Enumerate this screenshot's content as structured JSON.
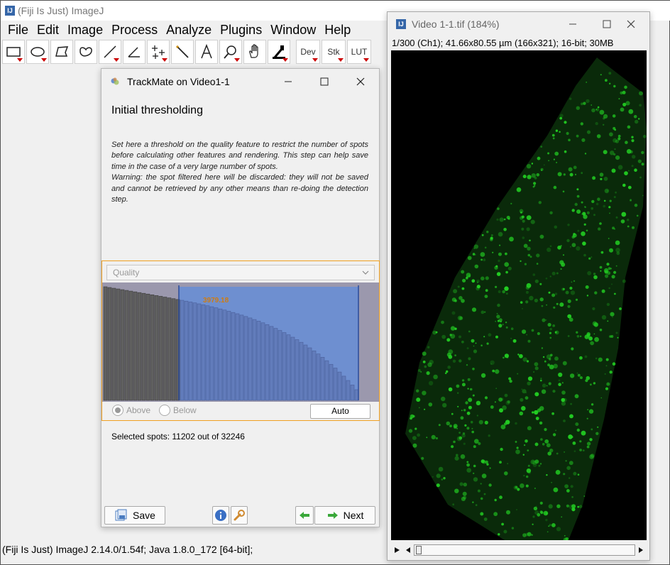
{
  "app": {
    "title": "(Fiji Is Just) ImageJ",
    "logo_text": "IJ",
    "menus": [
      "File",
      "Edit",
      "Image",
      "Process",
      "Analyze",
      "Plugins",
      "Window",
      "Help"
    ],
    "tools": [
      {
        "name": "rectangle-icon"
      },
      {
        "name": "oval-icon"
      },
      {
        "name": "polygon-icon"
      },
      {
        "name": "freehand-icon"
      },
      {
        "name": "line-icon"
      },
      {
        "name": "angle-icon"
      },
      {
        "name": "multipoint-icon"
      },
      {
        "name": "wand-icon"
      },
      {
        "name": "text-icon"
      },
      {
        "name": "magnifier-icon"
      },
      {
        "name": "hand-icon"
      },
      {
        "name": "dropper-icon"
      }
    ],
    "text_tools": [
      "Dev",
      "Stk",
      "LUT"
    ],
    "status": "(Fiji Is Just) ImageJ 2.14.0/1.54f; Java 1.8.0_172 [64-bit];"
  },
  "trackmate": {
    "title": "TrackMate on Video1-1",
    "heading": "Initial thresholding",
    "description": "Set here a threshold on the quality feature to restrict the number of spots before calculating other features and rendering. This step can help save time in the case of a very large number of spots.\nWarning: the spot filtered here will be discarded: they will not be saved and cannot be retrieved by any other means than re-doing the detection step.",
    "feature_select": "Quality",
    "threshold_value": "3979.18",
    "radio_above": "Above",
    "radio_below": "Below",
    "auto_label": "Auto",
    "selected_spots": "Selected spots: 11202 out of 32246",
    "save_label": "Save",
    "next_label": "Next",
    "histogram_colors": {
      "background": "#9b98ad",
      "bars": "#606060",
      "selected_region": "#6e8fd0"
    }
  },
  "video": {
    "title": "Video 1-1.tif (184%)",
    "info": "1/300 (Ch1); 41.66x80.55 µm (166x321); 16-bit; 30MB",
    "signal_color": "#22cc22"
  }
}
